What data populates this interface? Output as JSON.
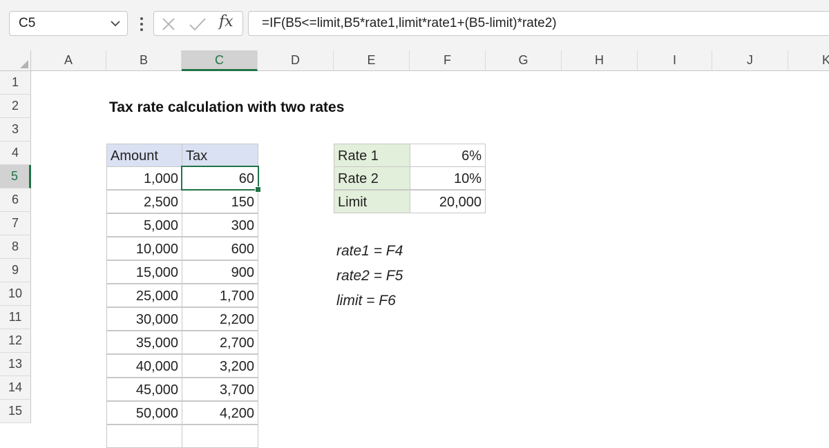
{
  "formula_bar": {
    "name_box": "C5",
    "fx_label": "fx",
    "formula": "=IF(B5<=limit,B5*rate1,limit*rate1+(B5-limit)*rate2)"
  },
  "columns": [
    "A",
    "B",
    "C",
    "D",
    "E",
    "F",
    "G",
    "H",
    "I",
    "J",
    "K"
  ],
  "rows": [
    "1",
    "2",
    "3",
    "4",
    "5",
    "6",
    "7",
    "8",
    "9",
    "10",
    "11",
    "12",
    "13",
    "14",
    "15"
  ],
  "sheet": {
    "title": "Tax rate calculation with two rates",
    "table_headers": {
      "amount": "Amount",
      "tax": "Tax"
    },
    "table_rows": [
      {
        "amount": "1,000",
        "tax": "60"
      },
      {
        "amount": "2,500",
        "tax": "150"
      },
      {
        "amount": "5,000",
        "tax": "300"
      },
      {
        "amount": "10,000",
        "tax": "600"
      },
      {
        "amount": "15,000",
        "tax": "900"
      },
      {
        "amount": "25,000",
        "tax": "1,700"
      },
      {
        "amount": "30,000",
        "tax": "2,200"
      },
      {
        "amount": "35,000",
        "tax": "2,700"
      },
      {
        "amount": "40,000",
        "tax": "3,200"
      },
      {
        "amount": "45,000",
        "tax": "3,700"
      },
      {
        "amount": "50,000",
        "tax": "4,200"
      }
    ],
    "params": [
      {
        "label": "Rate 1",
        "value": "6%"
      },
      {
        "label": "Rate 2",
        "value": "10%"
      },
      {
        "label": "Limit",
        "value": "20,000"
      }
    ],
    "notes": [
      "rate1 = F4",
      "rate2 = F5",
      "limit = F6"
    ]
  },
  "colors": {
    "header_fill": "#d9e1f2",
    "label_fill": "#e2efda",
    "selection": "#217346"
  }
}
